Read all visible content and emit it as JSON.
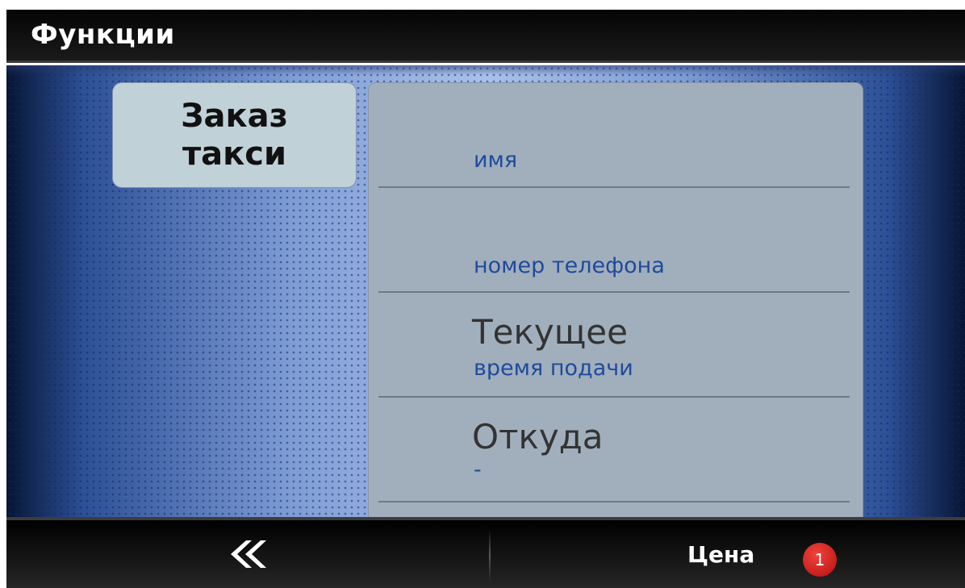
{
  "header": {
    "title": "Функции"
  },
  "tile": {
    "label": "Заказ\nтакси"
  },
  "form": {
    "rows": [
      {
        "value": "",
        "label": "имя"
      },
      {
        "value": "",
        "label": "номер телефона"
      },
      {
        "value": "Текущее",
        "label": "время подачи"
      },
      {
        "value": "Откуда",
        "label": "-"
      }
    ]
  },
  "footer": {
    "back_icon": "double-chevron-left-icon",
    "back_glyph": "«",
    "price_label": "Цена",
    "badge_count": "1"
  },
  "colors": {
    "accent_label": "#1f4a9c",
    "badge": "#d9221c",
    "panel": "#a1afbc",
    "tile": "#c0d1d8"
  }
}
